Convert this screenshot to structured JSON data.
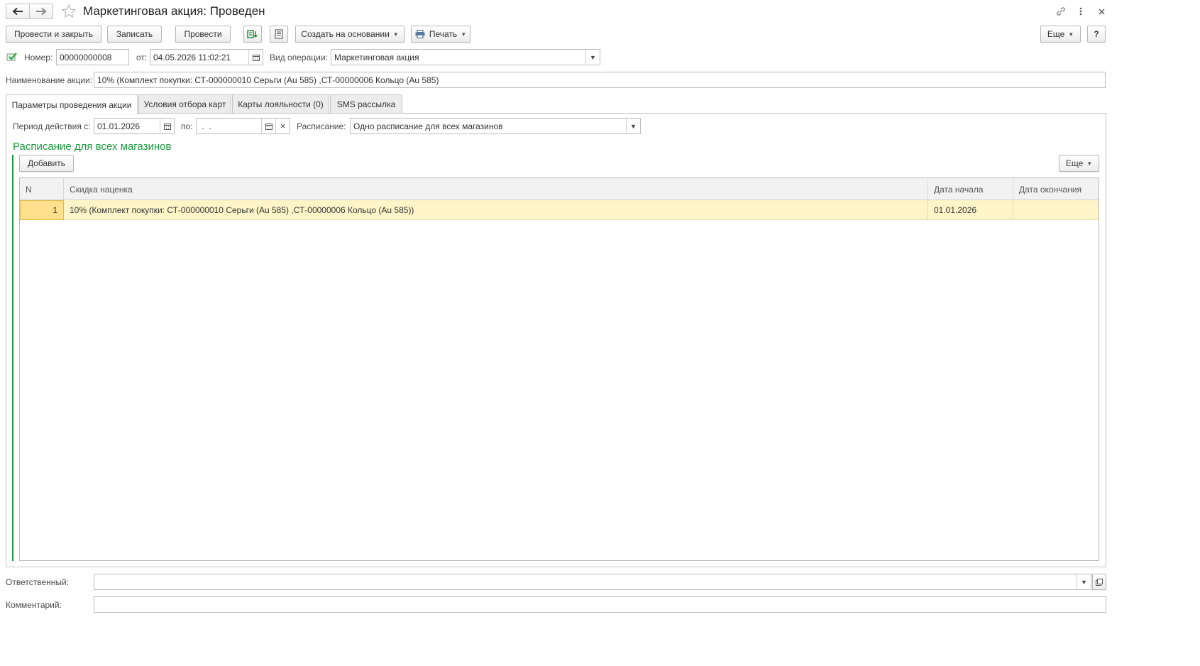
{
  "window": {
    "title": "Маркетинговая акция: Проведен"
  },
  "toolbar": {
    "post_close": "Провести и закрыть",
    "save": "Записать",
    "post": "Провести",
    "create_based": "Создать на основании",
    "print": "Печать",
    "more": "Еще",
    "help": "?"
  },
  "header": {
    "number_label": "Номер:",
    "number_value": "00000000008",
    "from_label": "от:",
    "date_value": "04.05.2026 11:02:21",
    "operation_label": "Вид операции:",
    "operation_value": "Маркетинговая акция",
    "name_label": "Наименование акции:",
    "name_value": "10% (Комплект покупки: СТ-000000010 Серьги (Au 585) ,СТ-00000006 Кольцо (Au 585)"
  },
  "tabs": [
    {
      "label": "Параметры проведения акции",
      "active": true
    },
    {
      "label": "Условия отбора карт",
      "active": false
    },
    {
      "label": "Карты лояльности (0)",
      "active": false
    },
    {
      "label": "SMS рассылка",
      "active": false
    }
  ],
  "params": {
    "period_label": "Период действия с:",
    "period_from": "01.01.2026",
    "to_label": "по:",
    "period_to": " .  . ",
    "schedule_label": "Расписание:",
    "schedule_value": "Одно расписание для всех магазинов",
    "group_title": "Расписание для всех магазинов",
    "add_button": "Добавить",
    "more": "Еще"
  },
  "table": {
    "columns": [
      "N",
      "Скидка наценка",
      "Дата начала",
      "Дата окончания"
    ],
    "rows": [
      {
        "n": "1",
        "discount": "10% (Комплект покупки: СТ-000000010 Серьги (Au 585) ,СТ-00000006 Кольцо (Au 585))",
        "start": "01.01.2026",
        "end": ""
      }
    ]
  },
  "footer": {
    "responsible_label": "Ответственный:",
    "responsible_value": "",
    "comment_label": "Комментарий:",
    "comment_value": ""
  },
  "colors": {
    "accent_green": "#1a9c3e",
    "selected_row": "#fdf5c7",
    "selected_cell": "#ffe08c"
  },
  "icons": {
    "back": "arrow-left-icon",
    "forward": "arrow-right-icon",
    "favorite": "star-icon",
    "link": "link-icon",
    "menu": "vertical-dots-icon",
    "close": "close-icon",
    "posted": "posted-check-icon"
  }
}
